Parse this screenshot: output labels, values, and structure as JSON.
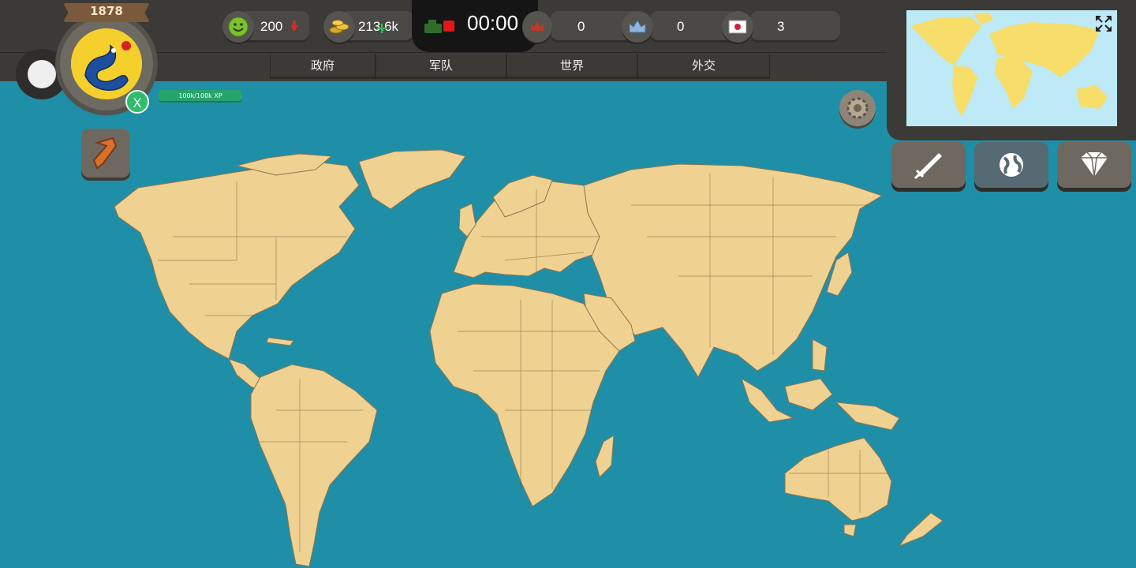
{
  "year": "1878",
  "timer": "00:00",
  "resources": [
    {
      "name": "happiness",
      "icon": "smiley-icon",
      "value": "200",
      "trend": "down"
    },
    {
      "name": "money",
      "icon": "coins-icon",
      "value": "213.6k",
      "trend": "up"
    },
    {
      "name": "military",
      "icon": "tank-icon",
      "value": "",
      "trend": ""
    },
    {
      "name": "alliance-red",
      "icon": "red-crown-icon",
      "value": "0",
      "trend": ""
    },
    {
      "name": "alliance-blue",
      "icon": "blue-crown-icon",
      "value": "0",
      "trend": ""
    },
    {
      "name": "diplomacy",
      "icon": "japan-flag-icon",
      "value": "3",
      "trend": ""
    }
  ],
  "nav_tabs": [
    "政府",
    "军队",
    "世界",
    "外交"
  ],
  "xp": {
    "label": "100k/100k XP",
    "fraction": 1.0
  },
  "player_badge": "X",
  "right_buttons": [
    {
      "name": "war",
      "icon": "sword-icon"
    },
    {
      "name": "world",
      "icon": "globe-icon"
    },
    {
      "name": "premium",
      "icon": "diamond-icon"
    }
  ],
  "colors": {
    "ocean": "#1f8fa7",
    "land": "#efd291",
    "bar": "#3b3a37",
    "xp_green": "#27a36c",
    "emblem_yellow": "#f5cf2c"
  }
}
